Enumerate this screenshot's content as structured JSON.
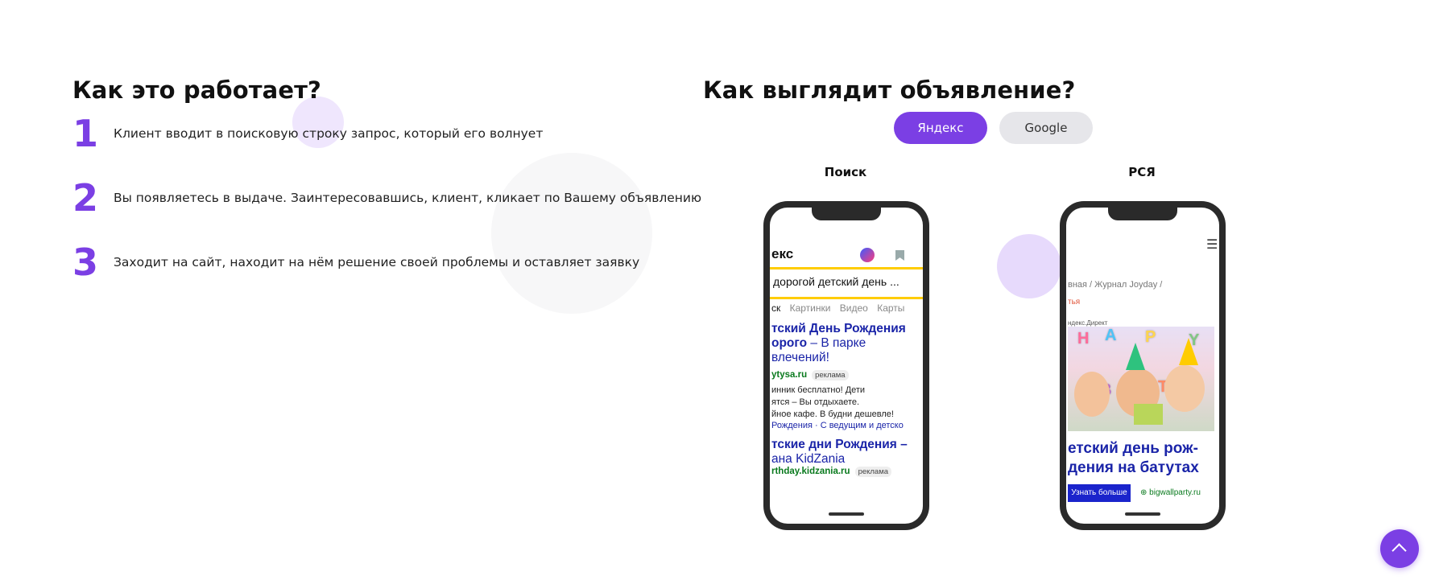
{
  "how": {
    "title": "Как это работает?",
    "steps": [
      {
        "num": "1",
        "text": "Клиент вводит в поисковую строку запрос, который его волнует"
      },
      {
        "num": "2",
        "text": "Вы появляетесь в выдаче. Заинтересовавшись, клиент, кликает по Вашему объявлению"
      },
      {
        "num": "3",
        "text": "Заходит на сайт, находит на нём решение своей проблемы и оставляет заявку"
      }
    ]
  },
  "ad": {
    "title": "Как выглядит объявление?",
    "tabs": {
      "yandex": "Яндекс",
      "google": "Google",
      "active": "yandex"
    },
    "labels": {
      "search": "Поиск",
      "rsya": "РСЯ"
    },
    "search_screen": {
      "logo": "екс",
      "query": "дорогой детский день ...",
      "tabs": [
        "ск",
        "Картинки",
        "Видео",
        "Карты"
      ],
      "ad1_title_1": "тский День Рождения",
      "ad1_title_2a": "орого",
      "ad1_title_2b": " – В парке",
      "ad1_title_3": "влечений!",
      "ad1_domain": "ytysa.ru",
      "ad_badge": "реклама",
      "ad1_text_1": "инник бесплатно! Дети",
      "ad1_text_2": "ятся – Вы отдыхаете.",
      "ad1_text_3": "йное кафе. В будни дешевле!",
      "ad1_links": "Рождения  ·  С ведущим и детско",
      "ad2_title_1": "тские дни Рождения –",
      "ad2_title_2": "ана KidZania",
      "ad2_domain": "rthday.kidzania.ru"
    },
    "rsya_screen": {
      "crumbs": "вная  /    Журнал Joyday  /",
      "crumbs2": "тья",
      "label": "ндекс.Директ",
      "title_1": "етский день рож-",
      "title_2": "дения на батутах",
      "button": "Узнать больше",
      "site": "bigwallparty.ru"
    }
  },
  "icons": {
    "scroll_top": "chevron-up-icon"
  },
  "colors": {
    "accent": "#7b3fe4",
    "tab_inactive": "#e6e6ea"
  }
}
